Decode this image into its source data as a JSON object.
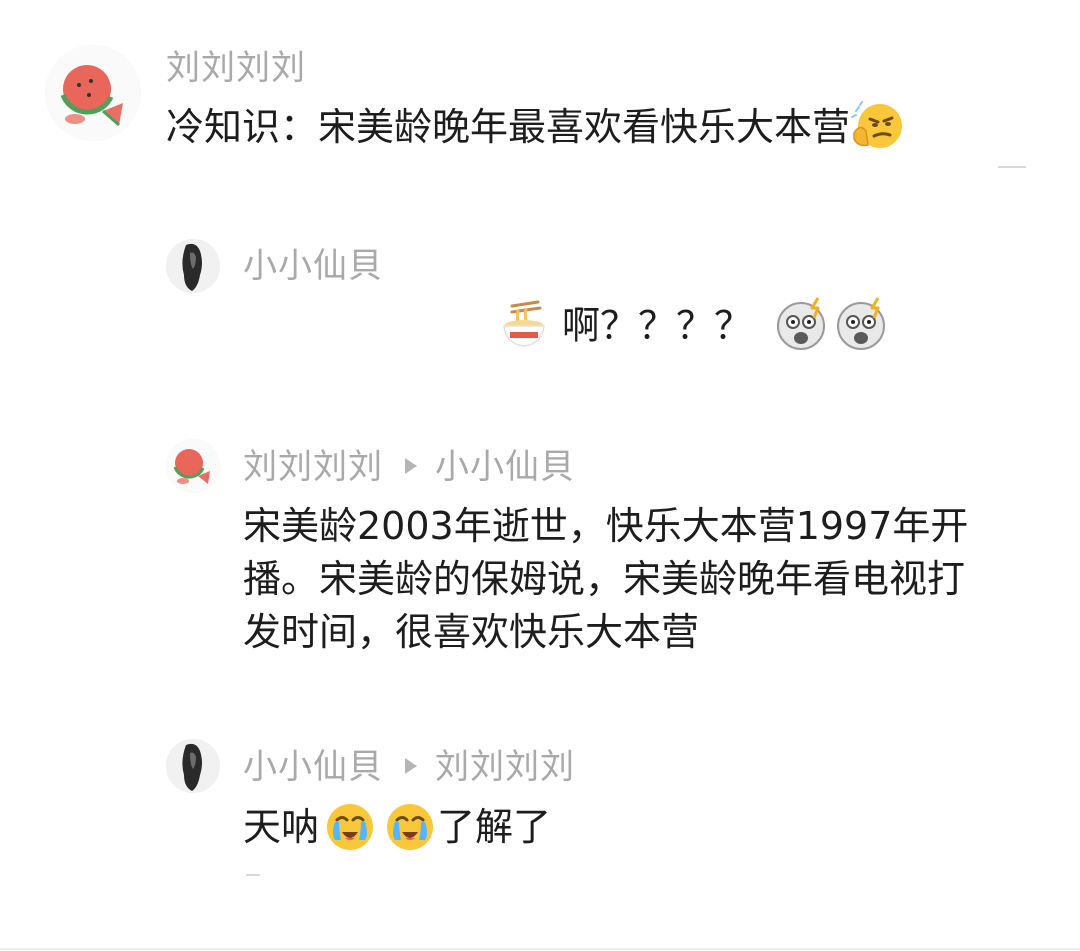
{
  "comments": [
    {
      "author": "刘刘刘刘",
      "text": "冷知识：宋美龄晚年最喜欢看快乐大本营",
      "emojis": [
        "smirk-thinking-emoji"
      ]
    },
    {
      "author": "小小仙貝",
      "text": "啊？？？？",
      "emojis": [
        "noodle-bowl-emoji",
        "shocked-face-emoji",
        "shocked-face-emoji"
      ]
    },
    {
      "author": "刘刘刘刘",
      "reply_to": "小小仙貝",
      "lines": [
        "宋美龄2003年逝世，快乐大本营1997年开",
        "播。宋美龄的保姆说，宋美龄晚年看电视打",
        "发时间，很喜欢快乐大本营"
      ]
    },
    {
      "author": "小小仙貝",
      "reply_to": "刘刘刘刘",
      "text_before": "天呐",
      "text_after": "了解了",
      "emojis": [
        "crying-face-emoji",
        "crying-face-emoji"
      ]
    }
  ],
  "colors": {
    "name": "#a9a9a9",
    "text": "#1d1d1d",
    "emoji_yellow": "#f8c73a"
  }
}
